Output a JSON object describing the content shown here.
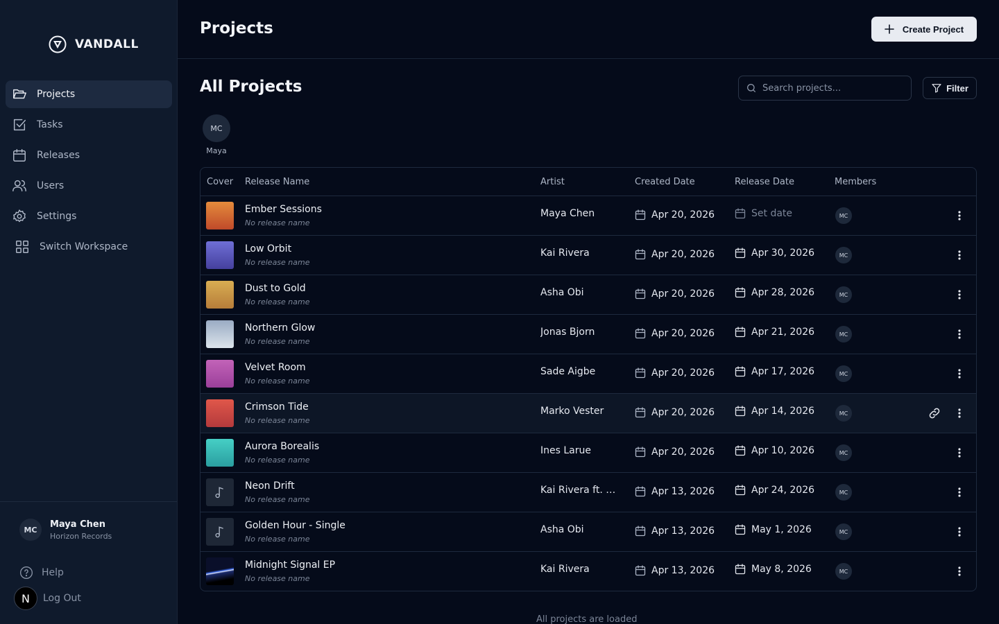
{
  "sidebar": {
    "brand": "VANDALL",
    "nav": [
      "Projects",
      "Tasks",
      "Releases",
      "Users",
      "Settings",
      "Switch Workspace"
    ],
    "user": {
      "initials": "MC",
      "name": "Maya Chen",
      "org": "Horizon Records"
    },
    "help": "Help",
    "logout": "Log Out",
    "badge": "N"
  },
  "header": {
    "title": "Projects",
    "create_label": "Create Project"
  },
  "main": {
    "section_title": "All Projects",
    "search_placeholder": "Search projects...",
    "filter_label": "Filter",
    "member_filter": {
      "initials": "MC",
      "name": "Maya"
    },
    "columns": [
      "Cover",
      "Release Name",
      "Artist",
      "Created Date",
      "Release Date",
      "Members"
    ],
    "rows": [
      {
        "name": "Ember Sessions",
        "sub": "No release name",
        "artist": "Maya Chen",
        "created": "Apr 20, 2026",
        "release": "Set date",
        "member": "MC",
        "cover": "linear-gradient(180deg,#e48b3c,#c04a2a)"
      },
      {
        "name": "Low Orbit",
        "sub": "No release name",
        "artist": "Kai Rivera",
        "created": "Apr 20, 2026",
        "release": "Apr 30, 2026",
        "member": "MC",
        "cover": "linear-gradient(180deg,#6f6fd6,#45409e)"
      },
      {
        "name": "Dust to Gold",
        "sub": "No release name",
        "artist": "Asha Obi",
        "created": "Apr 20, 2026",
        "release": "Apr 28, 2026",
        "member": "MC",
        "cover": "linear-gradient(180deg,#d8ad52,#b77d3a)"
      },
      {
        "name": "Northern Glow",
        "sub": "No release name",
        "artist": "Jonas Bjorn",
        "created": "Apr 20, 2026",
        "release": "Apr 21, 2026",
        "member": "MC",
        "cover": "linear-gradient(180deg,#9aabc3,#dbe4ec)"
      },
      {
        "name": "Velvet Room",
        "sub": "No release name",
        "artist": "Sade Aigbe",
        "created": "Apr 20, 2026",
        "release": "Apr 17, 2026",
        "member": "MC",
        "cover": "linear-gradient(180deg,#c263b8,#9b3f9a)"
      },
      {
        "name": "Crimson Tide",
        "sub": "No release name",
        "artist": "Marko Vester",
        "created": "Apr 20, 2026",
        "release": "Apr 14, 2026",
        "member": "MC",
        "cover": "linear-gradient(180deg,#e0574a,#b43a3c)"
      },
      {
        "name": "Aurora Borealis",
        "sub": "No release name",
        "artist": "Ines Larue",
        "created": "Apr 20, 2026",
        "release": "Apr 10, 2026",
        "member": "MC",
        "cover": "linear-gradient(180deg,#46cfc5,#2a9ea0)"
      },
      {
        "name": "Neon Drift",
        "sub": "No release name",
        "artist": "Kai Rivera ft. As...",
        "created": "Apr 13, 2026",
        "release": "Apr 24, 2026",
        "member": "MC",
        "cover": "note"
      },
      {
        "name": "Golden Hour - Single",
        "sub": "No release name",
        "artist": "Asha Obi",
        "created": "Apr 13, 2026",
        "release": "May 1, 2026",
        "member": "MC",
        "cover": "note"
      },
      {
        "name": "Midnight Signal EP",
        "sub": "No release name",
        "artist": "Kai Rivera",
        "created": "Apr 13, 2026",
        "release": "May 8, 2026",
        "member": "MC",
        "cover": "linear-gradient(170deg,#0a0f2a 0%,#0a0f2a 45%,#3c6cf0 50%,#e0e8ff 52%,#1a2a6a 56%,#000 80%)"
      }
    ],
    "footer_note": "All projects are loaded"
  }
}
